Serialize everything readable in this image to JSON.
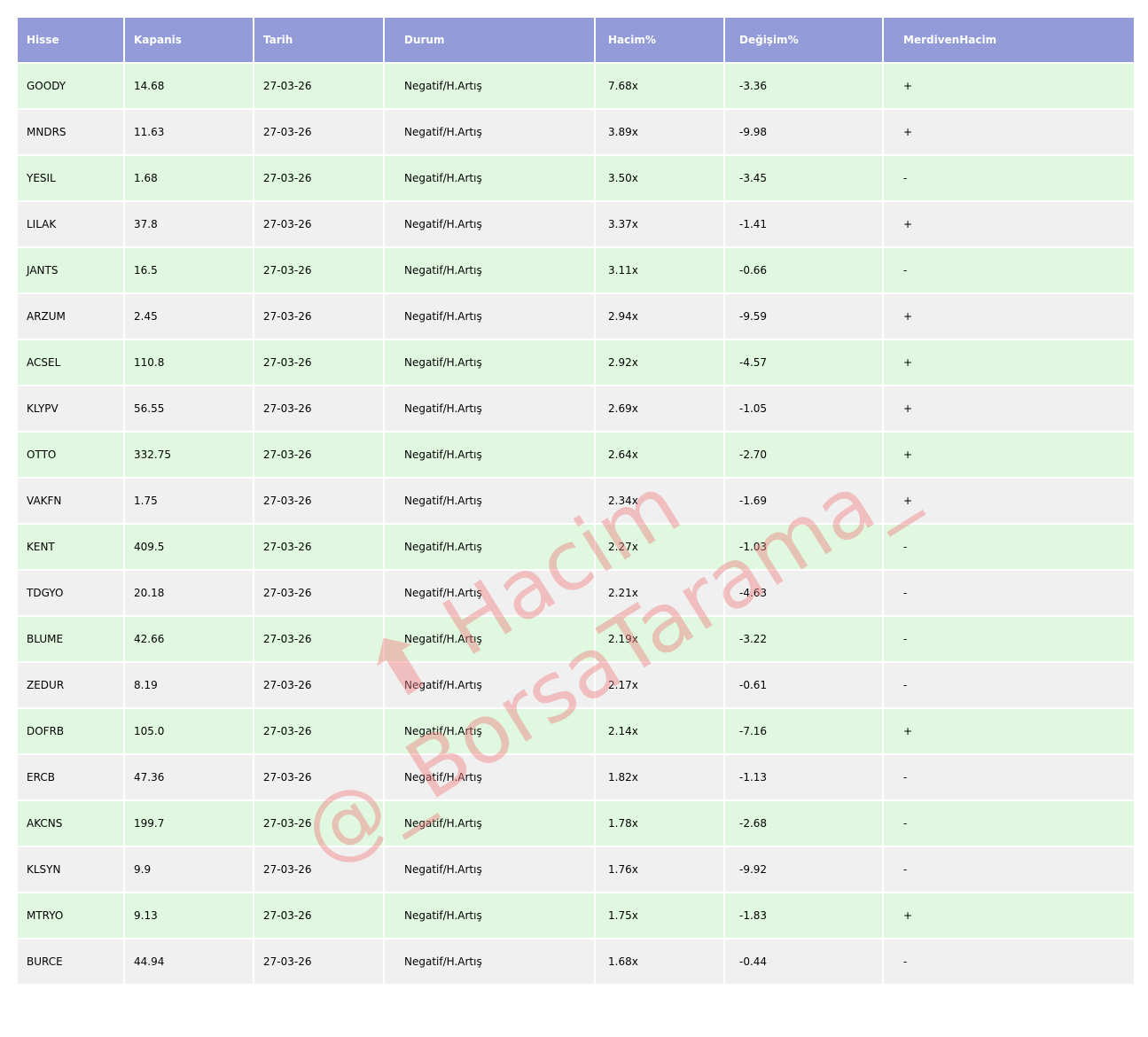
{
  "table": {
    "headers": [
      "Hisse",
      "Kapanis",
      "Tarih",
      "Durum",
      "Hacim%",
      "Değişim%",
      "MerdivenHacim"
    ],
    "rows": [
      [
        "GOODY",
        "14.68",
        "27-03-26",
        "Negatif/H.Artış",
        "7.68x",
        "-3.36",
        "+"
      ],
      [
        "MNDRS",
        "11.63",
        "27-03-26",
        "Negatif/H.Artış",
        "3.89x",
        "-9.98",
        "+"
      ],
      [
        "YESIL",
        "1.68",
        "27-03-26",
        "Negatif/H.Artış",
        "3.50x",
        "-3.45",
        "-"
      ],
      [
        "LILAK",
        "37.8",
        "27-03-26",
        "Negatif/H.Artış",
        "3.37x",
        "-1.41",
        "+"
      ],
      [
        "JANTS",
        "16.5",
        "27-03-26",
        "Negatif/H.Artış",
        "3.11x",
        "-0.66",
        "-"
      ],
      [
        "ARZUM",
        "2.45",
        "27-03-26",
        "Negatif/H.Artış",
        "2.94x",
        "-9.59",
        "+"
      ],
      [
        "ACSEL",
        "110.8",
        "27-03-26",
        "Negatif/H.Artış",
        "2.92x",
        "-4.57",
        "+"
      ],
      [
        "KLYPV",
        "56.55",
        "27-03-26",
        "Negatif/H.Artış",
        "2.69x",
        "-1.05",
        "+"
      ],
      [
        "OTTO",
        "332.75",
        "27-03-26",
        "Negatif/H.Artış",
        "2.64x",
        "-2.70",
        "+"
      ],
      [
        "VAKFN",
        "1.75",
        "27-03-26",
        "Negatif/H.Artış",
        "2.34x",
        "-1.69",
        "+"
      ],
      [
        "KENT",
        "409.5",
        "27-03-26",
        "Negatif/H.Artış",
        "2.27x",
        "-1.03",
        "-"
      ],
      [
        "TDGYO",
        "20.18",
        "27-03-26",
        "Negatif/H.Artış",
        "2.21x",
        "-4.63",
        "-"
      ],
      [
        "BLUME",
        "42.66",
        "27-03-26",
        "Negatif/H.Artış",
        "2.19x",
        "-3.22",
        "-"
      ],
      [
        "ZEDUR",
        "8.19",
        "27-03-26",
        "Negatif/H.Artış",
        "2.17x",
        "-0.61",
        "-"
      ],
      [
        "DOFRB",
        "105.0",
        "27-03-26",
        "Negatif/H.Artış",
        "2.14x",
        "-7.16",
        "+"
      ],
      [
        "ERCB",
        "47.36",
        "27-03-26",
        "Negatif/H.Artış",
        "1.82x",
        "-1.13",
        "-"
      ],
      [
        "AKCNS",
        "199.7",
        "27-03-26",
        "Negatif/H.Artış",
        "1.78x",
        "-2.68",
        "-"
      ],
      [
        "KLSYN",
        "9.9",
        "27-03-26",
        "Negatif/H.Artış",
        "1.76x",
        "-9.92",
        "-"
      ],
      [
        "MTRYO",
        "9.13",
        "27-03-26",
        "Negatif/H.Artış",
        "1.75x",
        "-1.83",
        "+"
      ],
      [
        "BURCE",
        "44.94",
        "27-03-26",
        "Negatif/H.Artış",
        "1.68x",
        "-0.44",
        "-"
      ]
    ]
  },
  "colors": {
    "header": "#939bd8",
    "row_green": "#dff8df",
    "row_gray": "#f0f0f0",
    "watermark": "#f08080"
  },
  "watermark": {
    "line1": "⬆ Hacim",
    "line2": "@_BorsaTarama_"
  }
}
